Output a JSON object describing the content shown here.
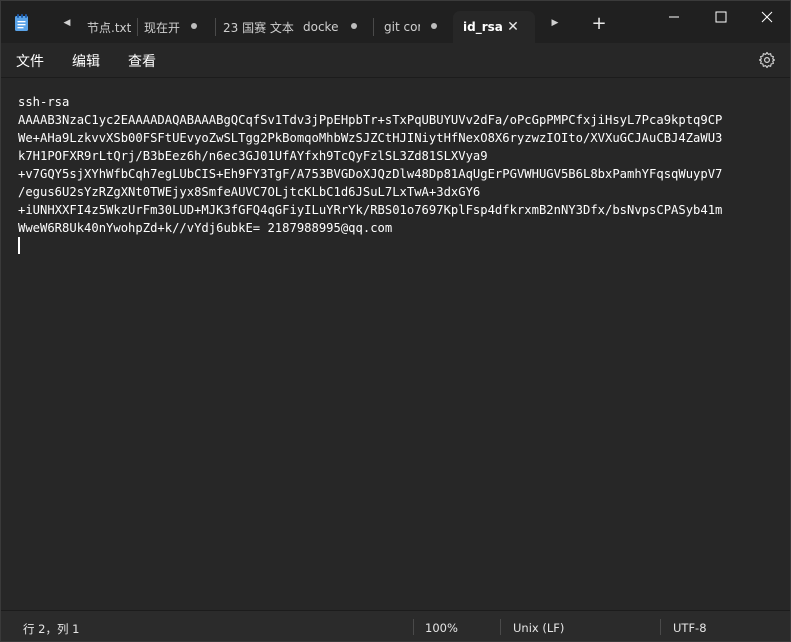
{
  "titlebar": {
    "tabs": [
      {
        "label": "节点.txt",
        "state": "plain"
      },
      {
        "label": "现在开",
        "state": "modified"
      },
      {
        "label": "23 国赛 文本",
        "state": "plain"
      },
      {
        "label": "docker",
        "state": "modified"
      },
      {
        "label": "git cor",
        "state": "modified"
      },
      {
        "label": "id_rsa",
        "state": "active"
      }
    ],
    "new_tab_label": "+"
  },
  "menu": {
    "file": "文件",
    "edit": "编辑",
    "view": "查看"
  },
  "editor": {
    "lines": [
      "ssh-rsa",
      "AAAAB3NzaC1yc2EAAAADAQABAAABgQCqfSv1Tdv3jPpEHpbTr+sTxPqUBUYUVv2dFa/oPcGpPMPCfxjiHsyL7Pca9kptq9CP",
      "We+AHa9LzkvvXSb00FSFtUEvyoZwSLTgg2PkBomqoMhbWzSJZCtHJINiytHfNexO8X6ryzwzIOIto/XVXuGCJAuCBJ4ZaWU3",
      "k7H1POFXR9rLtQrj/B3bEez6h/n6ec3GJ01UfAYfxh9TcQyFzlSL3Zd81SLXVya9",
      "+v7GQY5sjXYhWfbCqh7egLUbCIS+Eh9FY3TgF/A753BVGDoXJQzDlw48Dp81AqUgErPGVWHUGV5B6L8bxPamhYFqsqWuypV7",
      "/egus6U2sYzRZgXNt0TWEjyx8SmfeAUVC7OLjtcKLbC1d6JSuL7LxTwA+3dxGY6",
      "+iUNHXXFI4z5WkzUrFm30LUD+MJK3fGFQ4qGFiyILuYRrYk/RBS01o7697KplFsp4dfkrxmB2nNY3Dfx/bsNvpsCPASyb41m",
      "WweW6R8Uk40nYwohpZd+k//vYdj6ubkE= 2187988995@qq.com"
    ]
  },
  "status": {
    "position": "行 2，列 1",
    "zoom": "100%",
    "line_ending": "Unix (LF)",
    "encoding": "UTF-8"
  },
  "colors": {
    "background": "#272727",
    "titlebar": "#202020",
    "text": "#ffffff"
  }
}
